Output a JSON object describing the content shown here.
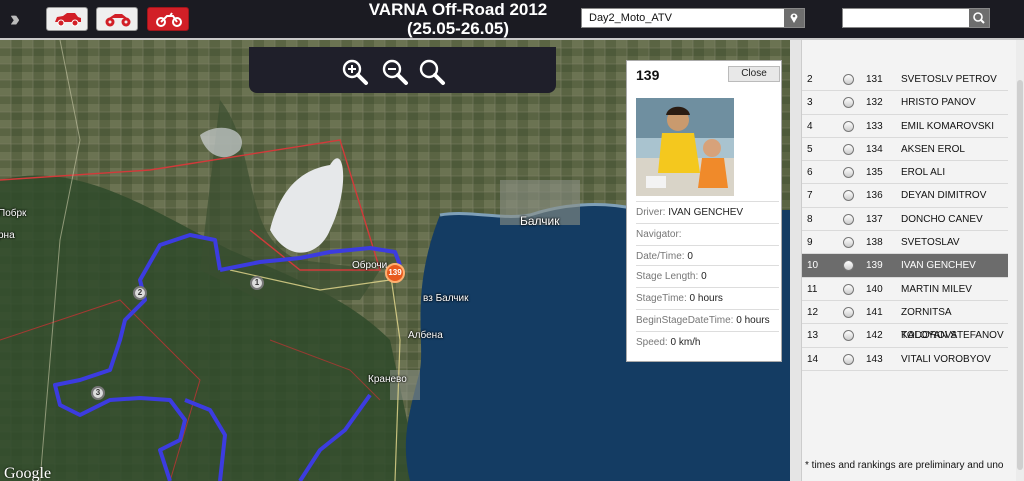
{
  "app": {
    "title_line1": "VARNA Off-Road 2012",
    "title_line2": "(25.05-26.05)",
    "stage_select_value": "Day2_Moto_ATV",
    "search_placeholder": ""
  },
  "colors": {
    "topbar": "#1b1b22",
    "moto_active": "#d21f27",
    "track": "#3c3ce0",
    "selected_row": "#6c6c6c"
  },
  "map": {
    "labels": [
      {
        "text": "Балчик",
        "big": true
      },
      {
        "text": "Оброчи"
      },
      {
        "text": "вз Балчик"
      },
      {
        "text": "Албена"
      },
      {
        "text": "Кранево"
      },
      {
        "text": "Побрк"
      },
      {
        "text": "рна"
      }
    ],
    "google_logo": "Google",
    "waypoints": [
      "1",
      "2",
      "3"
    ],
    "marker": "139"
  },
  "popup": {
    "number": "139",
    "close_label": "Close",
    "fields": [
      {
        "label": "Driver:",
        "value": "IVAN GENCHEV"
      },
      {
        "label": "Navigator:",
        "value": ""
      },
      {
        "label": "Date/Time:",
        "value": "0"
      },
      {
        "label": "Stage Length:",
        "value": "0"
      },
      {
        "label": "StageTime:",
        "value": "0 hours"
      },
      {
        "label": "BeginStageDateTime:",
        "value": "0 hours"
      },
      {
        "label": "Speed:",
        "value": "0 km/h"
      }
    ]
  },
  "ranking": {
    "rows": [
      {
        "pos": "2",
        "nr": "131",
        "name": "SVETOSLV PETROV"
      },
      {
        "pos": "3",
        "nr": "132",
        "name": "HRISTO PANOV"
      },
      {
        "pos": "4",
        "nr": "133",
        "name": "EMIL KOMAROVSKI"
      },
      {
        "pos": "5",
        "nr": "134",
        "name": "AKSEN EROL"
      },
      {
        "pos": "6",
        "nr": "135",
        "name": "EROL ALI"
      },
      {
        "pos": "7",
        "nr": "136",
        "name": "DEYAN DIMITROV"
      },
      {
        "pos": "8",
        "nr": "137",
        "name": "DONCHO CANEV"
      },
      {
        "pos": "9",
        "nr": "138",
        "name": "SVETOSLAV GENCHEV"
      },
      {
        "pos": "10",
        "nr": "139",
        "name": "IVAN GENCHEV",
        "selected": true
      },
      {
        "pos": "11",
        "nr": "140",
        "name": "MARTIN MILEV"
      },
      {
        "pos": "12",
        "nr": "141",
        "name": "ZORNITSA TODOROVA"
      },
      {
        "pos": "13",
        "nr": "142",
        "name": "KALOYAN STEFANOV"
      },
      {
        "pos": "14",
        "nr": "143",
        "name": "VITALI VOROBYOV"
      }
    ],
    "footnote": "* times and rankings are preliminary and uno"
  }
}
